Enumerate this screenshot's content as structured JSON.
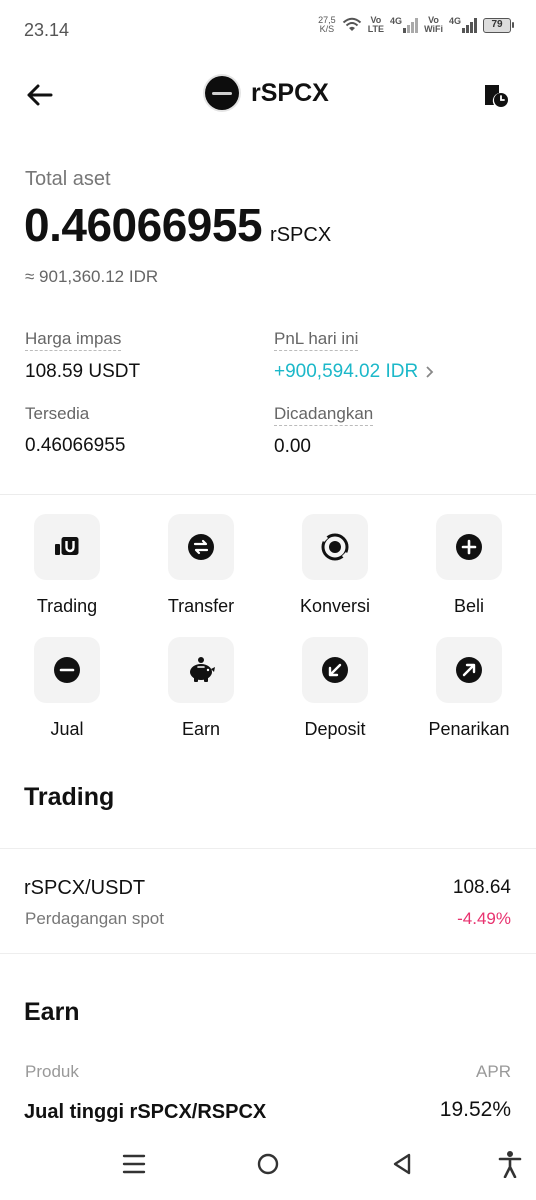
{
  "status": {
    "time": "23.14",
    "net_speed_value": "27,5",
    "net_speed_unit": "K/S",
    "volte_top": "Vo",
    "volte_bottom": "LTE",
    "net1": "4G",
    "vowifi_top": "Vo",
    "vowifi_bottom": "WiFi",
    "net2": "4G",
    "battery": "79"
  },
  "header": {
    "title": "rSPCX"
  },
  "total": {
    "label": "Total aset",
    "value": "0.46066955",
    "unit": "rSPCX",
    "idr": "≈ 901,360.12 IDR"
  },
  "stats": {
    "break_even_label": "Harga impas",
    "break_even_value": "108.59 USDT",
    "pnl_label": "PnL hari ini",
    "pnl_value": "+900,594.02 IDR",
    "available_label": "Tersedia",
    "available_value": "0.46066955",
    "reserved_label": "Dicadangkan",
    "reserved_value": "0.00"
  },
  "actions": [
    {
      "label": "Trading",
      "icon": "trading-icon"
    },
    {
      "label": "Transfer",
      "icon": "transfer-icon"
    },
    {
      "label": "Konversi",
      "icon": "convert-icon"
    },
    {
      "label": "Beli",
      "icon": "buy-icon"
    },
    {
      "label": "Jual",
      "icon": "sell-icon"
    },
    {
      "label": "Earn",
      "icon": "piggy-bank-icon"
    },
    {
      "label": "Deposit",
      "icon": "deposit-icon"
    },
    {
      "label": "Penarikan",
      "icon": "withdraw-icon"
    }
  ],
  "trading": {
    "title": "Trading",
    "pair": "rSPCX/USDT",
    "type": "Perdagangan spot",
    "price": "108.64",
    "change": "-4.49%"
  },
  "earn": {
    "title": "Earn",
    "col_product": "Produk",
    "col_apr": "APR",
    "product": "Jual tinggi rSPCX/RSPCX",
    "apr": "19.52%"
  },
  "colors": {
    "positive": "#1cb8c9",
    "negative": "#e8326f",
    "tile_bg": "#f3f3f3"
  }
}
